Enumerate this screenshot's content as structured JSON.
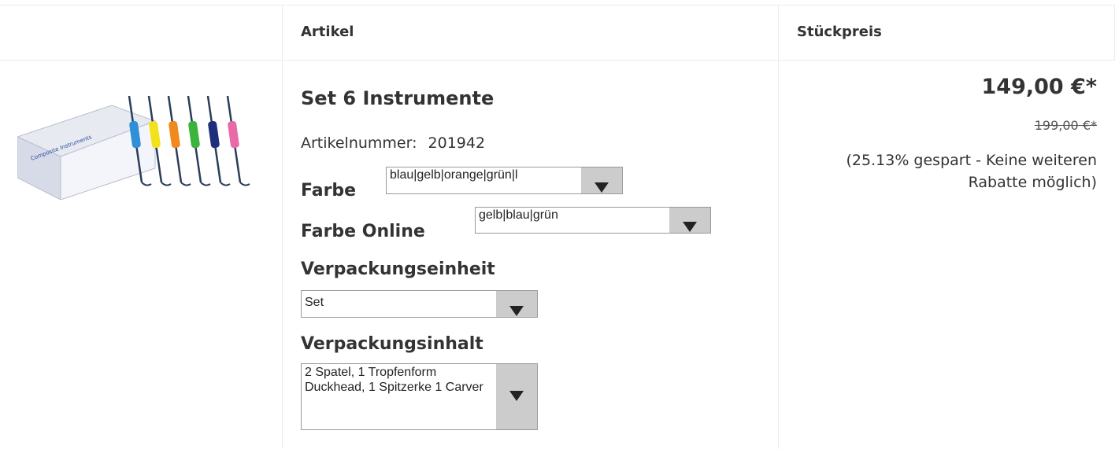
{
  "table": {
    "headers": {
      "artikel": "Artikel",
      "stueckpreis": "Stückpreis"
    }
  },
  "product": {
    "image_alt_icon": "dental-instruments-set-image",
    "title": "Set 6 Instrumente",
    "article_number_label": "Artikelnummer:",
    "article_number": "201942",
    "options": {
      "farbe": {
        "label": "Farbe",
        "value": "blau|gelb|orange|grün|l"
      },
      "farbe_online": {
        "label": "Farbe Online",
        "value": "gelb|blau|grün"
      },
      "verpackungseinheit": {
        "label": "Verpackungseinheit",
        "value": "Set"
      },
      "verpackungsinhalt": {
        "label": "Verpackungsinhalt",
        "value": "2 Spatel, 1 Tropfenform Duckhead, 1 Spitzerke 1 Carver"
      }
    }
  },
  "price": {
    "current": "149,00 €*",
    "old": "199,00 €*",
    "savings": "(25.13% gespart - Keine weiteren Rabatte möglich)"
  },
  "colors": {
    "instrument_colors": [
      "#2f8fd8",
      "#f2e21a",
      "#f08a1c",
      "#3cb43c",
      "#1f2f7a",
      "#e86aa8"
    ]
  }
}
